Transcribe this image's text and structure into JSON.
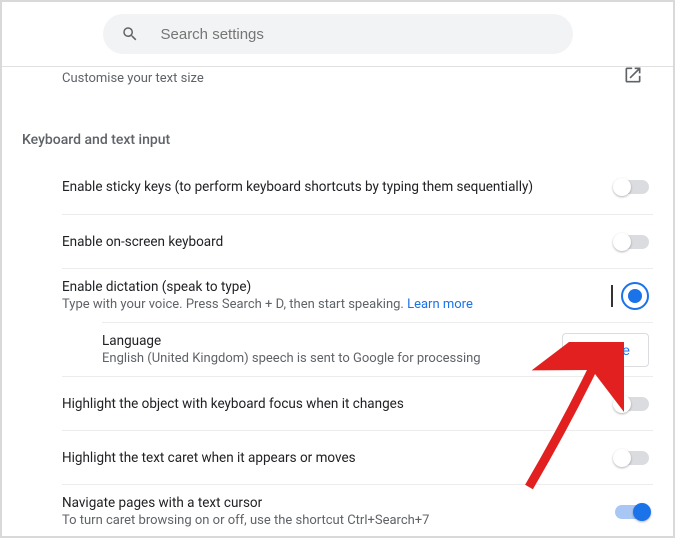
{
  "search": {
    "placeholder": "Search settings"
  },
  "partial_top": {
    "subtitle": "Customise your text size"
  },
  "section": {
    "title": "Keyboard and text input"
  },
  "rows": {
    "sticky": {
      "title": "Enable sticky keys (to perform keyboard shortcuts by typing them sequentially)"
    },
    "osk": {
      "title": "Enable on-screen keyboard"
    },
    "dictation": {
      "title": "Enable dictation (speak to type)",
      "sub": "Type with your voice. Press Search + D, then start speaking.  ",
      "learn": "Learn more"
    },
    "language": {
      "title": "Language",
      "sub": "English (United Kingdom) speech is sent to Google for processing",
      "button": "Change"
    },
    "focus": {
      "title": "Highlight the object with keyboard focus when it changes"
    },
    "caret": {
      "title": "Highlight the text caret when it appears or moves"
    },
    "navigate": {
      "title": "Navigate pages with a text cursor",
      "sub": "To turn caret browsing on or off, use the shortcut Ctrl+Search+7"
    }
  }
}
